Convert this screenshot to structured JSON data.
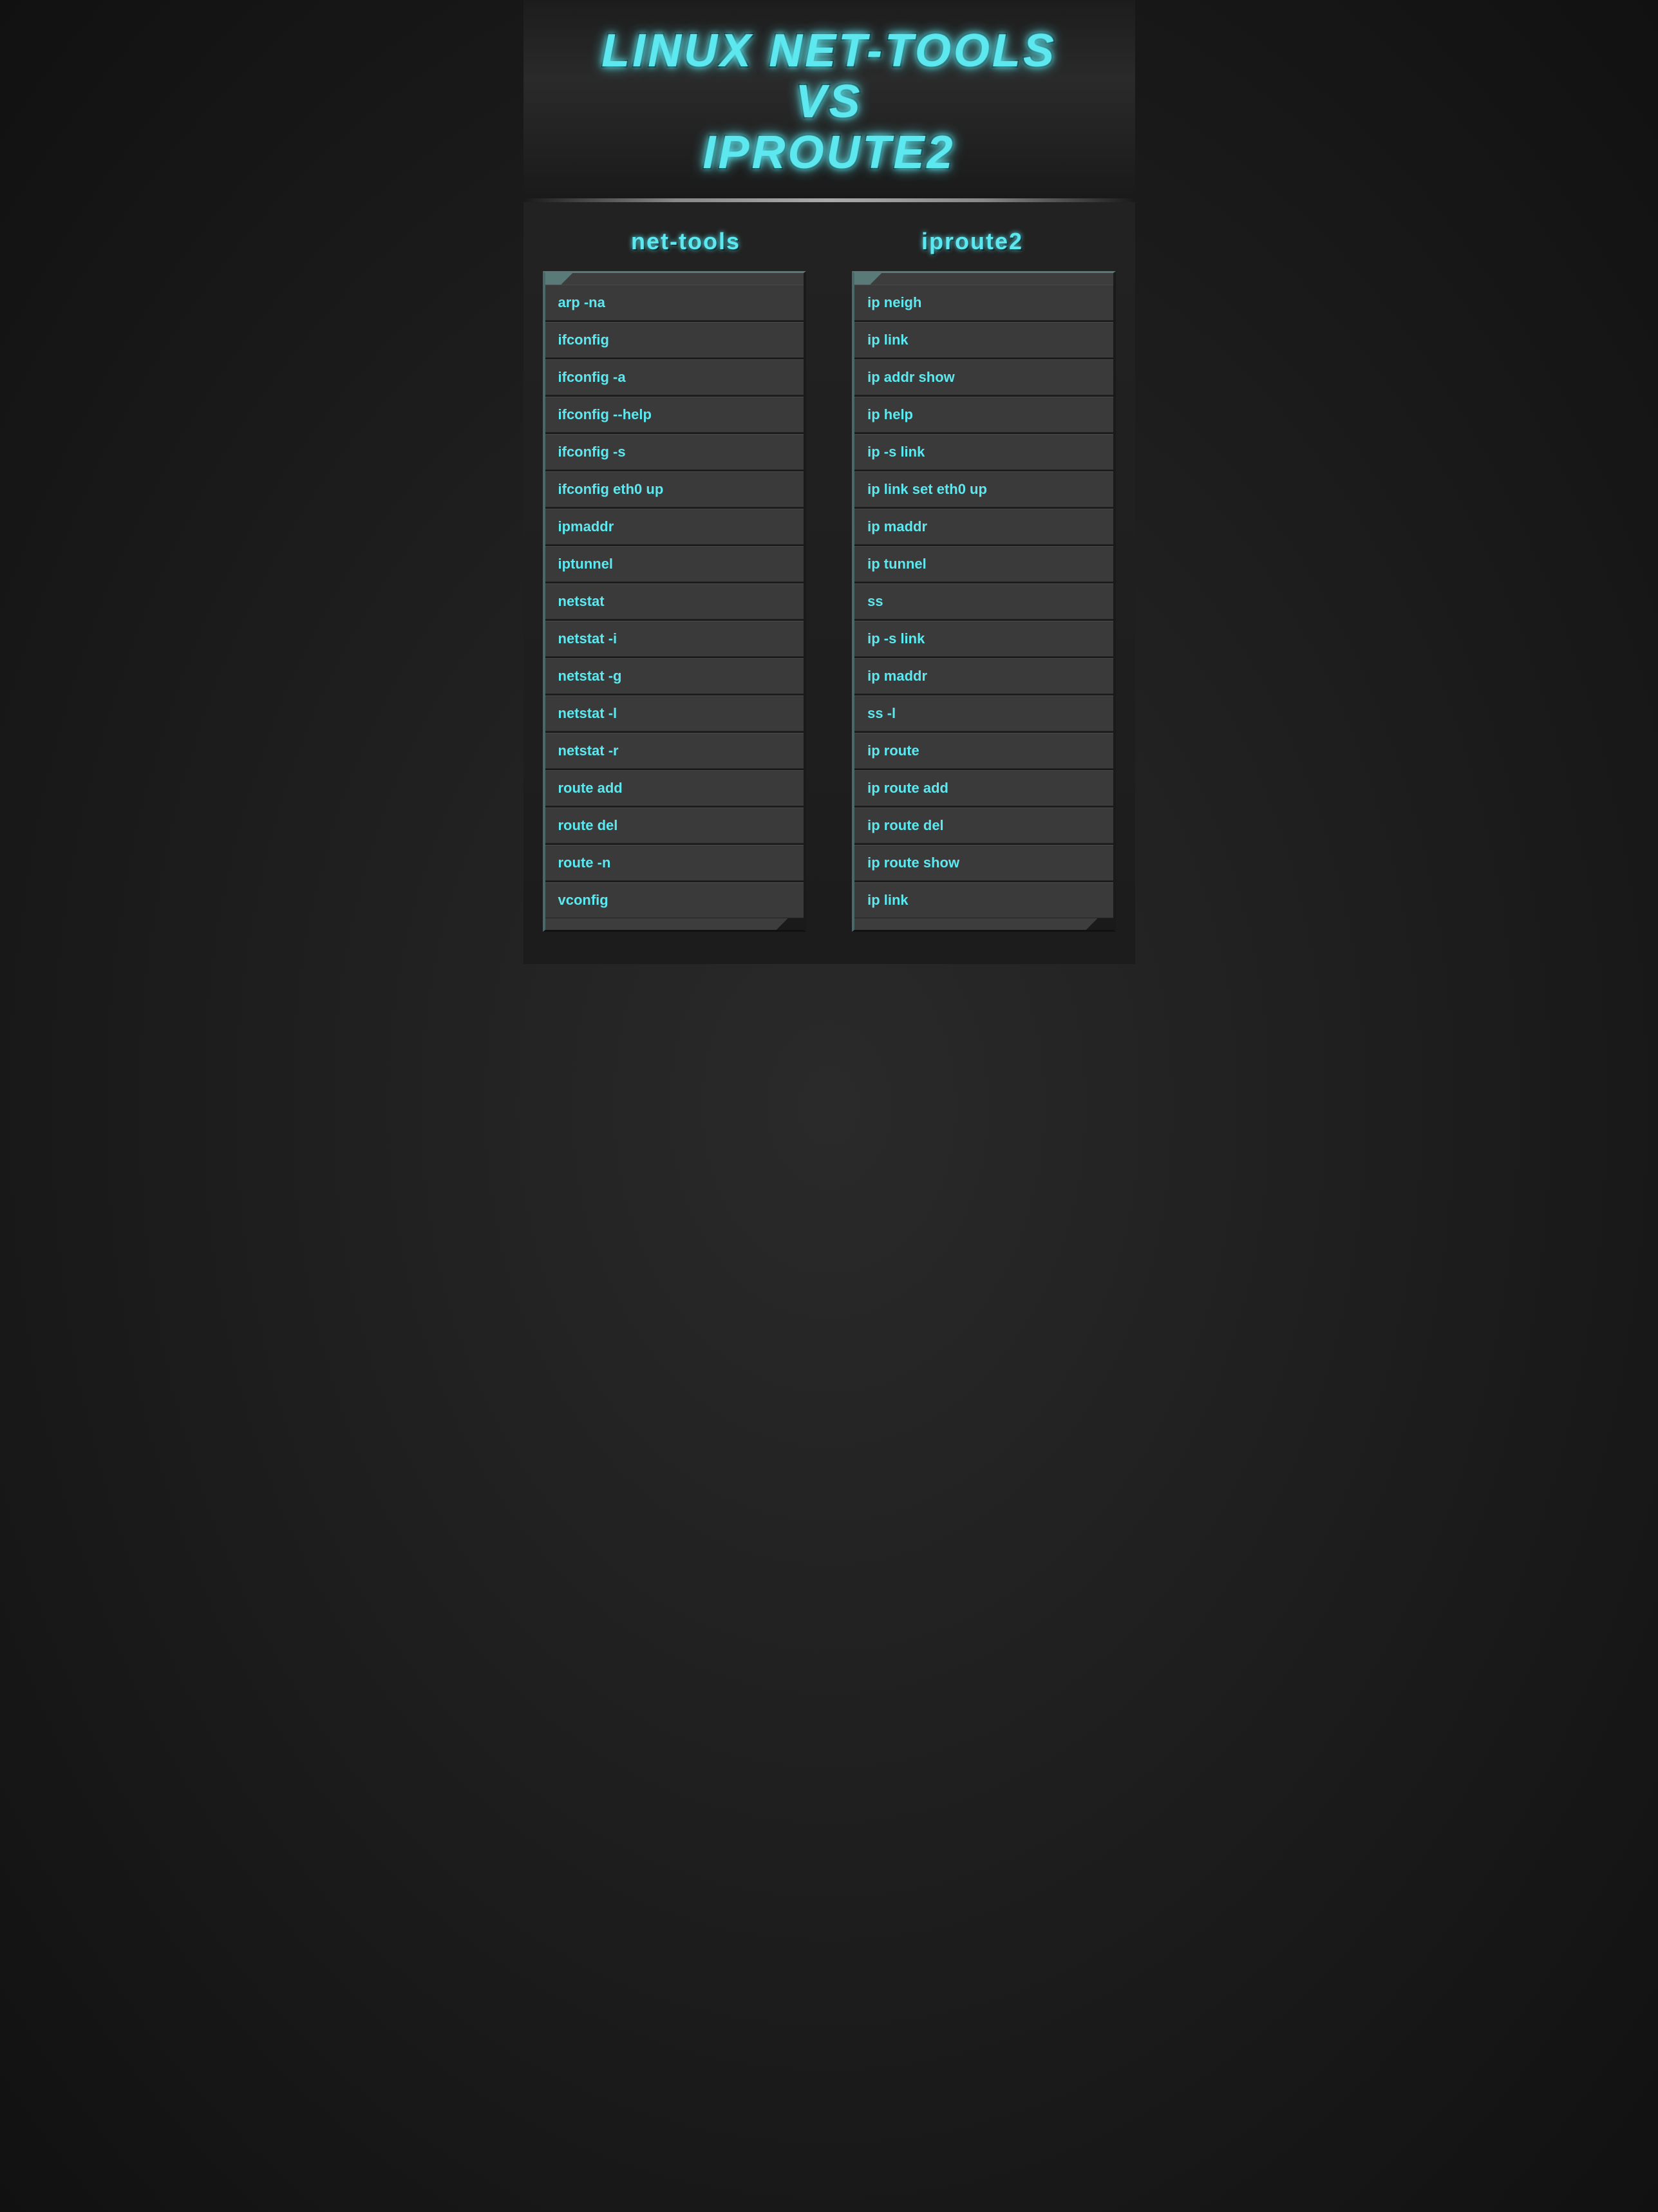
{
  "header": {
    "title_line1": "LINUX NET-TOOLS",
    "title_line2": "VS",
    "title_line3": "IPROUTE2"
  },
  "columns": {
    "left_header": "net-tools",
    "right_header": "iproute2"
  },
  "rows": [
    {
      "nettools": "arp -na",
      "iproute2": "ip neigh"
    },
    {
      "nettools": "ifconfig",
      "iproute2": "ip link"
    },
    {
      "nettools": "ifconfig -a",
      "iproute2": "ip addr show"
    },
    {
      "nettools": "ifconfig --help",
      "iproute2": "ip help"
    },
    {
      "nettools": "ifconfig -s",
      "iproute2": "ip -s link"
    },
    {
      "nettools": "ifconfig eth0 up",
      "iproute2": "ip link set eth0 up"
    },
    {
      "nettools": "ipmaddr",
      "iproute2": "ip maddr"
    },
    {
      "nettools": "iptunnel",
      "iproute2": "ip tunnel"
    },
    {
      "nettools": "netstat",
      "iproute2": "ss"
    },
    {
      "nettools": "netstat -i",
      "iproute2": "ip -s link"
    },
    {
      "nettools": "netstat  -g",
      "iproute2": "ip maddr"
    },
    {
      "nettools": "netstat -l",
      "iproute2": "ss -l"
    },
    {
      "nettools": "netstat -r",
      "iproute2": "ip route"
    },
    {
      "nettools": "route add",
      "iproute2": "ip route add"
    },
    {
      "nettools": "route del",
      "iproute2": "ip route del"
    },
    {
      "nettools": "route -n",
      "iproute2": "ip route show"
    },
    {
      "nettools": "vconfig",
      "iproute2": "ip link"
    }
  ],
  "colors": {
    "accent": "#5de8f0",
    "bg_dark": "#1a1a1a",
    "bg_row": "#3a3a3a",
    "border_light": "#5a7a7a"
  }
}
